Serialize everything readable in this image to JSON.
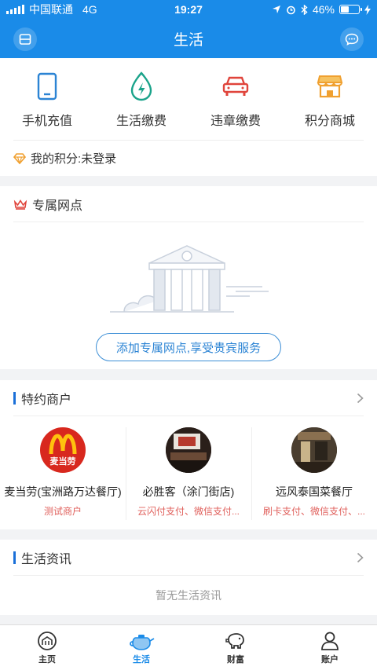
{
  "status_bar": {
    "carrier": "中国联通",
    "network": "4G",
    "time": "19:27",
    "battery": "46%",
    "battery_level": 0.46
  },
  "header": {
    "title": "生活",
    "left_icon": "card-icon",
    "right_icon": "chat-icon"
  },
  "services": [
    {
      "label": "手机充值",
      "icon": "phone-icon",
      "color": "#2c84d4"
    },
    {
      "label": "生活缴费",
      "icon": "drop-bolt-icon",
      "color": "#1aa38a"
    },
    {
      "label": "违章缴费",
      "icon": "car-icon",
      "color": "#e0443b"
    },
    {
      "label": "积分商城",
      "icon": "shop-icon",
      "color": "#f0a030"
    }
  ],
  "points": {
    "label": "我的积分:未登录",
    "icon": "diamond-icon"
  },
  "branch": {
    "title": "专属网点",
    "button": "添加专属网点,享受贵宾服务"
  },
  "merchants": {
    "title": "特约商户",
    "items": [
      {
        "name": "麦当劳(宝洲路万达餐厅)",
        "sub": "测试商户",
        "logo_text": "麦当劳"
      },
      {
        "name": "必胜客（涂门街店)",
        "sub": "云闪付支付、微信支付..."
      },
      {
        "name": "远风泰国菜餐厅",
        "sub": "刷卡支付、微信支付、..."
      }
    ]
  },
  "news": {
    "title": "生活资讯",
    "empty": "暂无生活资讯"
  },
  "tabs": [
    {
      "label": "主页",
      "icon": "home-icon",
      "active": false
    },
    {
      "label": "生活",
      "icon": "teapot-icon",
      "active": true
    },
    {
      "label": "财富",
      "icon": "piggy-bank-icon",
      "active": false
    },
    {
      "label": "账户",
      "icon": "user-icon",
      "active": false
    }
  ],
  "colors": {
    "primary": "#1a8be8",
    "accent_red": "#e0605c"
  }
}
